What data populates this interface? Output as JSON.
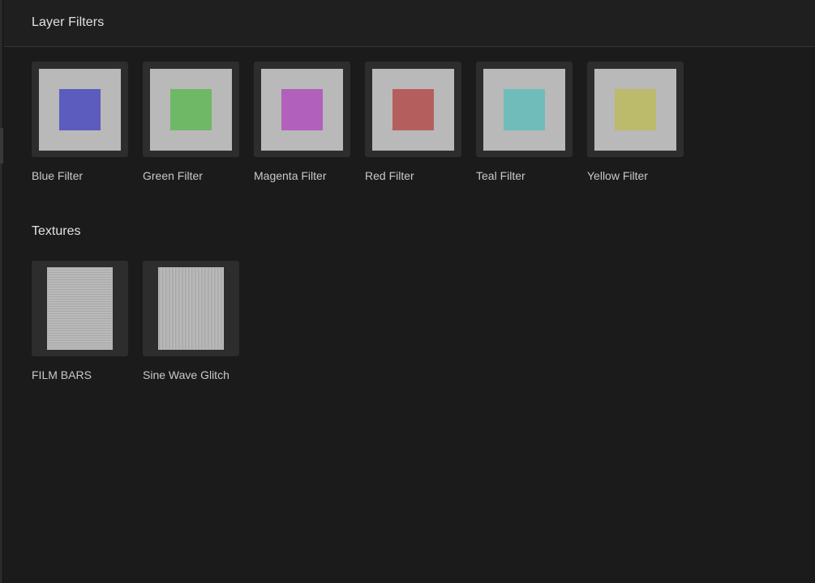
{
  "panel": {
    "title": "Layer Filters"
  },
  "filters": {
    "items": [
      {
        "label": "Blue Filter",
        "color": "#5b5cbd"
      },
      {
        "label": "Green Filter",
        "color": "#6fb866"
      },
      {
        "label": "Magenta Filter",
        "color": "#b161bb"
      },
      {
        "label": "Red Filter",
        "color": "#b55e5e"
      },
      {
        "label": "Teal Filter",
        "color": "#6fbcbb"
      },
      {
        "label": "Yellow Filter",
        "color": "#bcba6b"
      }
    ]
  },
  "textures": {
    "title": "Textures",
    "items": [
      {
        "label": "FILM BARS",
        "pattern": "horizontal-lines"
      },
      {
        "label": "Sine Wave Glitch",
        "pattern": "vertical-lines"
      }
    ]
  }
}
